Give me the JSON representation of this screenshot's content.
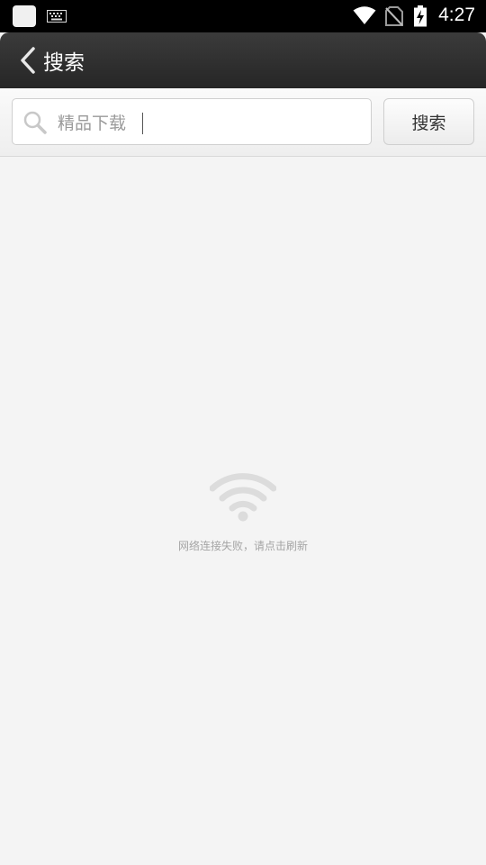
{
  "status_bar": {
    "time": "4:27",
    "icons": [
      "app-square-icon",
      "keyboard-icon",
      "wifi-icon",
      "no-sim-icon",
      "battery-charging-icon"
    ]
  },
  "header": {
    "title": "搜索"
  },
  "search": {
    "value": "精品下载",
    "button_label": "搜索"
  },
  "error": {
    "message": "网络连接失败，请点击刷新"
  },
  "colors": {
    "header_bg": "#2f2f2f",
    "page_bg": "#f4f4f4",
    "muted_text": "#a5a5a5"
  }
}
